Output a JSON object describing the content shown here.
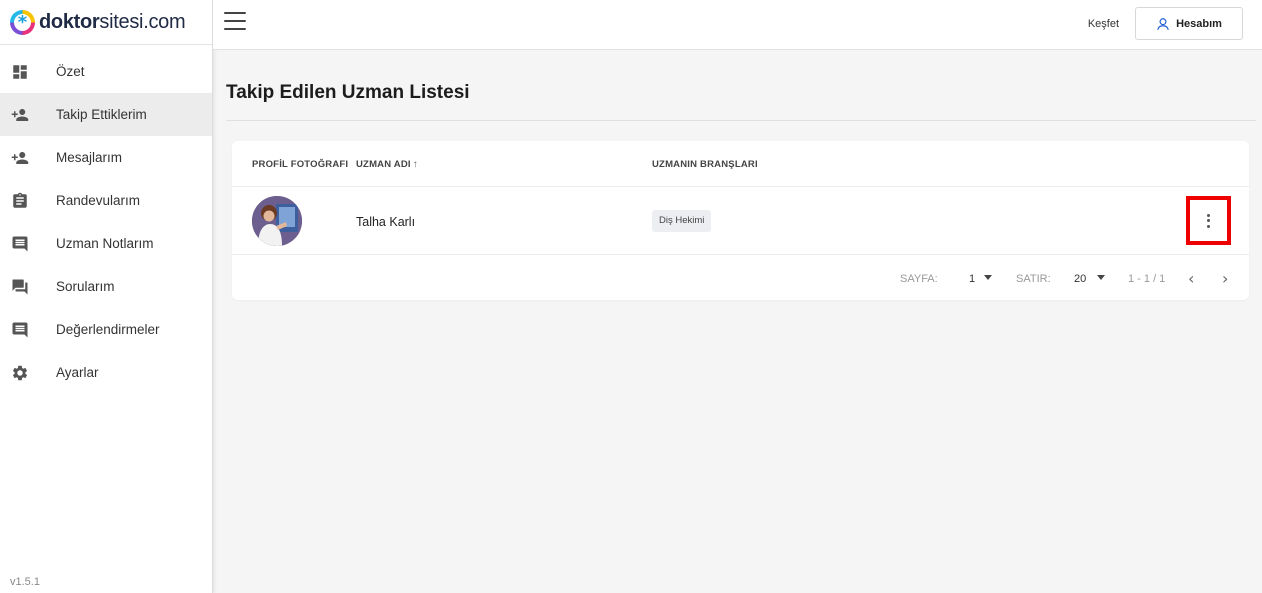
{
  "brand": {
    "name_bold": "doktor",
    "name_rest": "sitesi.com"
  },
  "sidebar": {
    "items": [
      {
        "label": "Özet",
        "icon": "dashboard-icon"
      },
      {
        "label": "Takip Ettiklerim",
        "icon": "person-add-icon",
        "active": true
      },
      {
        "label": "Mesajlarım",
        "icon": "person-add-icon"
      },
      {
        "label": "Randevularım",
        "icon": "clipboard-icon"
      },
      {
        "label": "Uzman Notlarım",
        "icon": "comment-icon"
      },
      {
        "label": "Sorularım",
        "icon": "forum-icon"
      },
      {
        "label": "Değerlendirmeler",
        "icon": "comment-icon"
      },
      {
        "label": "Ayarlar",
        "icon": "gear-icon"
      }
    ],
    "version": "v1.5.1"
  },
  "header": {
    "explore": "Keşfet",
    "account": "Hesabım",
    "accent": "#1e5fd6"
  },
  "main": {
    "title": "Takip Edilen Uzman Listesi",
    "table": {
      "columns": [
        "PROFİL FOTOĞRAFI",
        "UZMAN ADI",
        "UZMANIN BRANŞLARI"
      ],
      "sort_icon": "↑",
      "rows": [
        {
          "name": "Talha Karlı",
          "branch": "Diş Hekimi"
        }
      ]
    },
    "pagination": {
      "page_label": "SAYFA:",
      "page_value": "1",
      "rows_label": "SATIR:",
      "rows_value": "20",
      "range": "1 - 1 / 1",
      "prev": "‹",
      "next": "›"
    }
  },
  "highlight_color": "#ee0000"
}
